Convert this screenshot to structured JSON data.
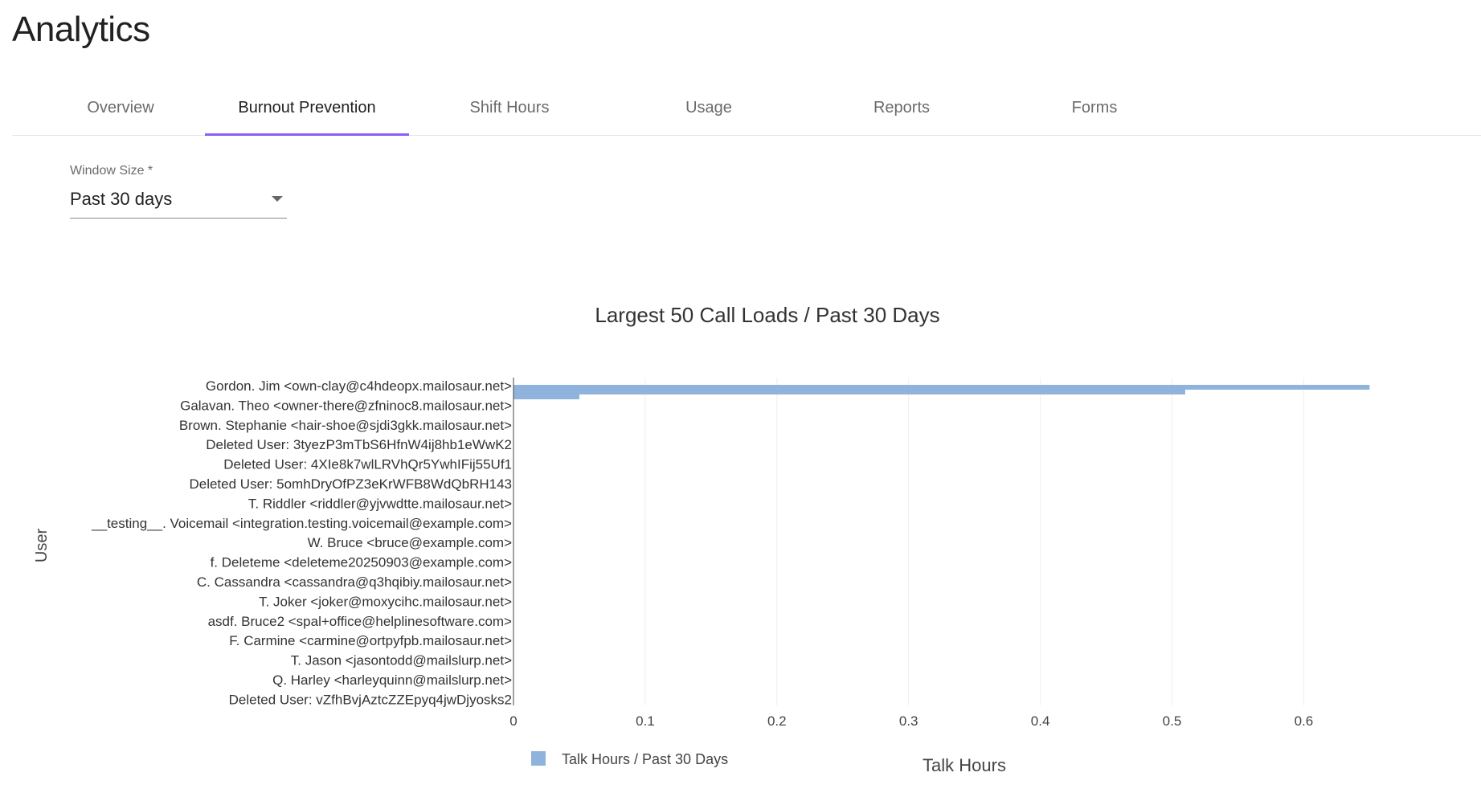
{
  "page": {
    "title": "Analytics"
  },
  "tabs": [
    {
      "label": "Overview",
      "active": false
    },
    {
      "label": "Burnout Prevention",
      "active": true
    },
    {
      "label": "Shift Hours",
      "active": false
    },
    {
      "label": "Usage",
      "active": false
    },
    {
      "label": "Reports",
      "active": false
    },
    {
      "label": "Forms",
      "active": false
    }
  ],
  "colors": {
    "accent": "#8b5cf6",
    "bar": "#8fb3dc"
  },
  "window_size": {
    "label": "Window Size *",
    "value": "Past 30 days",
    "icon": "chevron-down-icon"
  },
  "chart_data": {
    "type": "bar",
    "orientation": "horizontal",
    "title": "Largest 50 Call Loads / Past 30 Days",
    "xlabel": "Talk Hours",
    "ylabel": "User",
    "xlim": [
      0,
      0.65
    ],
    "xticks": [
      0,
      0.1,
      0.2,
      0.3,
      0.4,
      0.5,
      0.6
    ],
    "grid": true,
    "legend": "bottom-left",
    "categories": [
      "Gordon. Jim <own-clay@c4hdeopx.mailosaur.net>",
      "Galavan. Theo <owner-there@zfninoc8.mailosaur.net>",
      "Brown. Stephanie <hair-shoe@sjdi3gkk.mailosaur.net>",
      "Deleted User: 3tyezP3mTbS6HfnW4ij8hb1eWwK2",
      "Deleted User: 4XIe8k7wlLRVhQr5YwhIFij55Uf1",
      "Deleted User: 5omhDryOfPZ3eKrWFB8WdQbRH143",
      "T. Riddler <riddler@yjvwdtte.mailosaur.net>",
      "__testing__. Voicemail <integration.testing.voicemail@example.com>",
      "W. Bruce <bruce@example.com>",
      "f. Deleteme <deleteme20250903@example.com>",
      "C. Cassandra <cassandra@q3hqibiy.mailosaur.net>",
      "T. Joker <joker@moxycihc.mailosaur.net>",
      "asdf. Bruce2 <spal+office@helplinesoftware.com>",
      "F. Carmine <carmine@ortpyfpb.mailosaur.net>",
      "T. Jason <jasontodd@mailslurp.net>",
      "Q. Harley <harleyquinn@mailslurp.net>",
      "Deleted User: vZfhBvjAztcZZEpyq4jwDjyosks2"
    ],
    "series": [
      {
        "name": "Talk Hours / Past 30 Days",
        "values": [
          0.65,
          0.51,
          0.05,
          0,
          0,
          0,
          0,
          0,
          0,
          0,
          0,
          0,
          0,
          0,
          0,
          0,
          0
        ]
      }
    ]
  }
}
